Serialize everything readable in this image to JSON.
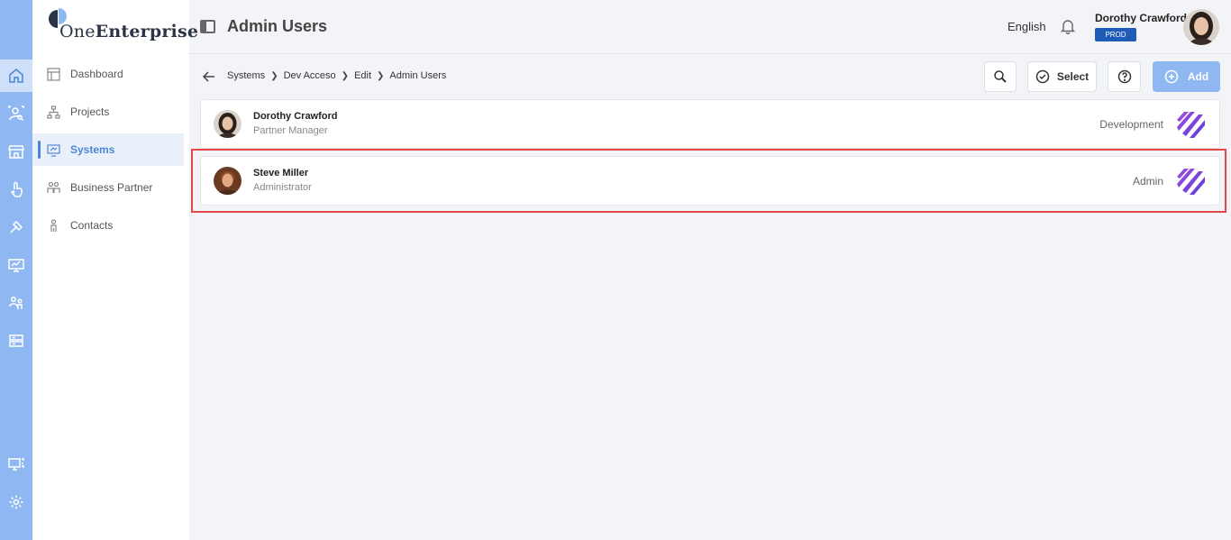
{
  "app": {
    "logo_prefix": "One",
    "logo_suffix": "Enterprise"
  },
  "rail": {
    "icons": [
      "home-icon",
      "user-search-icon",
      "store-icon",
      "touch-icon",
      "tools-icon",
      "monitor-chart-icon",
      "people-icon",
      "server-icon",
      "screen-qr-icon",
      "settings-icon"
    ]
  },
  "sidebar": {
    "items": [
      {
        "label": "Dashboard",
        "icon": "dashboard-icon"
      },
      {
        "label": "Projects",
        "icon": "hierarchy-icon"
      },
      {
        "label": "Systems",
        "icon": "systems-icon",
        "active": true
      },
      {
        "label": "Business Partner",
        "icon": "partner-icon"
      },
      {
        "label": "Contacts",
        "icon": "contact-icon"
      }
    ]
  },
  "header": {
    "title": "Admin Users",
    "language": "English",
    "user_name": "Dorothy Crawford",
    "environment": "PROD"
  },
  "breadcrumb": [
    "Systems",
    "Dev Acceso",
    "Edit",
    "Admin Users"
  ],
  "toolbar": {
    "select_label": "Select",
    "add_label": "Add"
  },
  "users": [
    {
      "name": "Dorothy Crawford",
      "title": "Partner Manager",
      "role": "Development"
    },
    {
      "name": "Steve Miller",
      "title": "Administrator",
      "role": "Admin"
    }
  ],
  "colors": {
    "accent": "#4a86d8",
    "rail": "#8fb8f2",
    "highlight": "#e4474a",
    "badge": "#1f5cb8"
  }
}
